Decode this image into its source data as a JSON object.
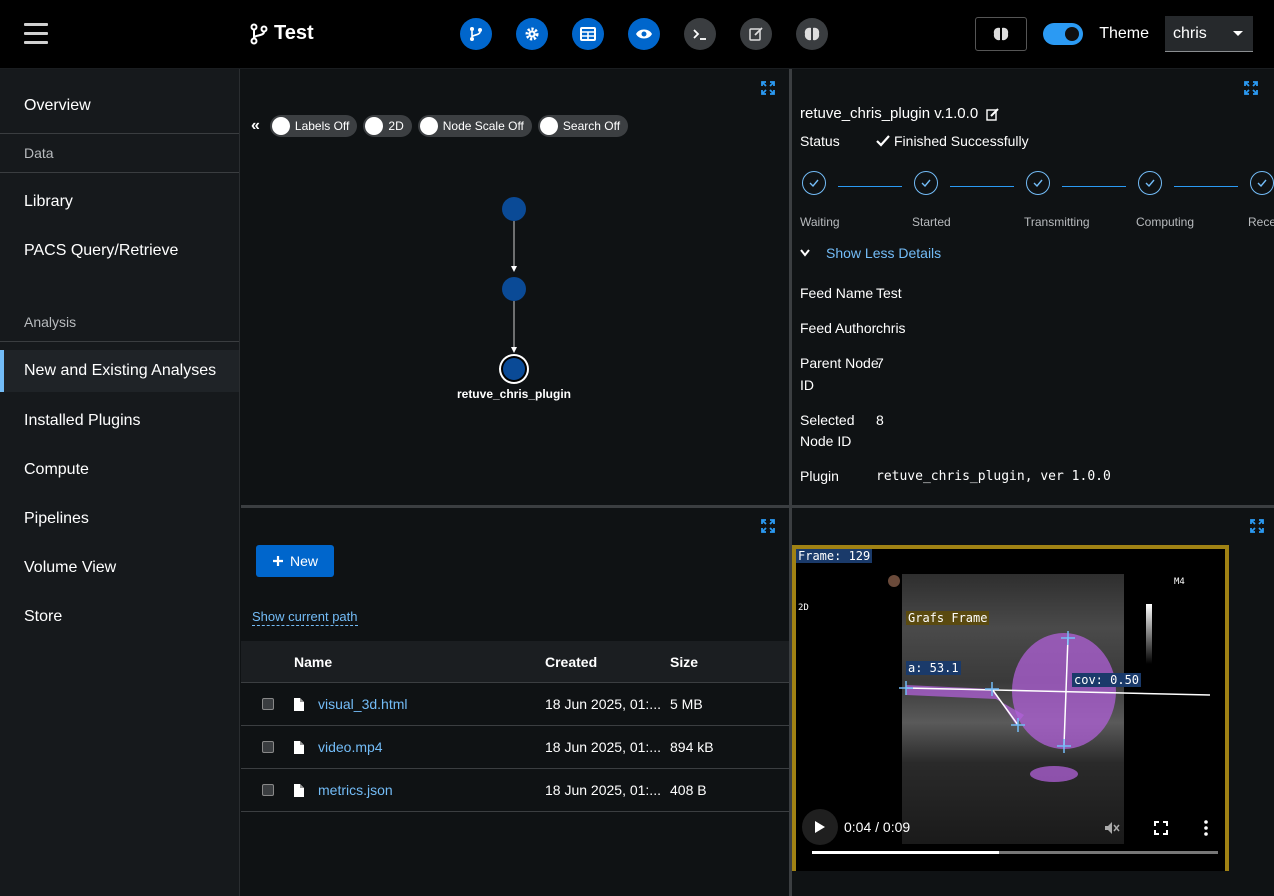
{
  "header": {
    "feed_title": "Test",
    "theme_label": "Theme",
    "user": "chris",
    "toolbar_icons": [
      "git-branch-icon",
      "gear-icon",
      "table-icon",
      "eye-icon",
      "terminal-icon",
      "edit-icon",
      "brain-icon"
    ]
  },
  "sidebar": {
    "overview": "Overview",
    "section_data": "Data",
    "library": "Library",
    "pacs": "PACS Query/Retrieve",
    "section_analysis": "Analysis",
    "new_existing": "New and Existing Analyses",
    "installed_plugins": "Installed Plugins",
    "compute": "Compute",
    "pipelines": "Pipelines",
    "volume_view": "Volume View",
    "store": "Store"
  },
  "graph": {
    "toggles": {
      "labels": "Labels Off",
      "dim": "2D",
      "node_scale": "Node Scale Off",
      "search": "Search Off"
    },
    "selected_node_label": "retuve_chris_plugin"
  },
  "details": {
    "title": "retuve_chris_plugin v.1.0.0",
    "status_label": "Status",
    "status_value": "Finished Successfully",
    "steps": [
      "Waiting",
      "Started",
      "Transmitting",
      "Computing",
      "Rece"
    ],
    "show_less": "Show Less Details",
    "feed_name_label": "Feed Name",
    "feed_name_value": "Test",
    "feed_author_label": "Feed Author",
    "feed_author_value": "chris",
    "parent_node_label_1": "Parent Node",
    "parent_node_label_2": "ID",
    "parent_node_value": "7",
    "selected_node_label_1": "Selected",
    "selected_node_label_2": "Node ID",
    "selected_node_value": "8",
    "plugin_label": "Plugin",
    "plugin_value": "retuve_chris_plugin, ver 1.0.0"
  },
  "files": {
    "new_button": "New",
    "show_path": "Show current path",
    "columns": {
      "name": "Name",
      "created": "Created",
      "size": "Size"
    },
    "rows": [
      {
        "name": "visual_3d.html",
        "created": "18 Jun 2025, 01:...",
        "size": "5 MB"
      },
      {
        "name": "video.mp4",
        "created": "18 Jun 2025, 01:...",
        "size": "894 kB"
      },
      {
        "name": "metrics.json",
        "created": "18 Jun 2025, 01:...",
        "size": "408 B"
      }
    ]
  },
  "video": {
    "frame_label": "Frame: 129",
    "grafs_label": "Grafs Frame",
    "alpha_label": "a: 53.1",
    "cov_label": "cov: 0.50",
    "mode_label": "2D",
    "m4_label": "M4",
    "time": "0:04 / 0:09",
    "progress": 0.46
  }
}
